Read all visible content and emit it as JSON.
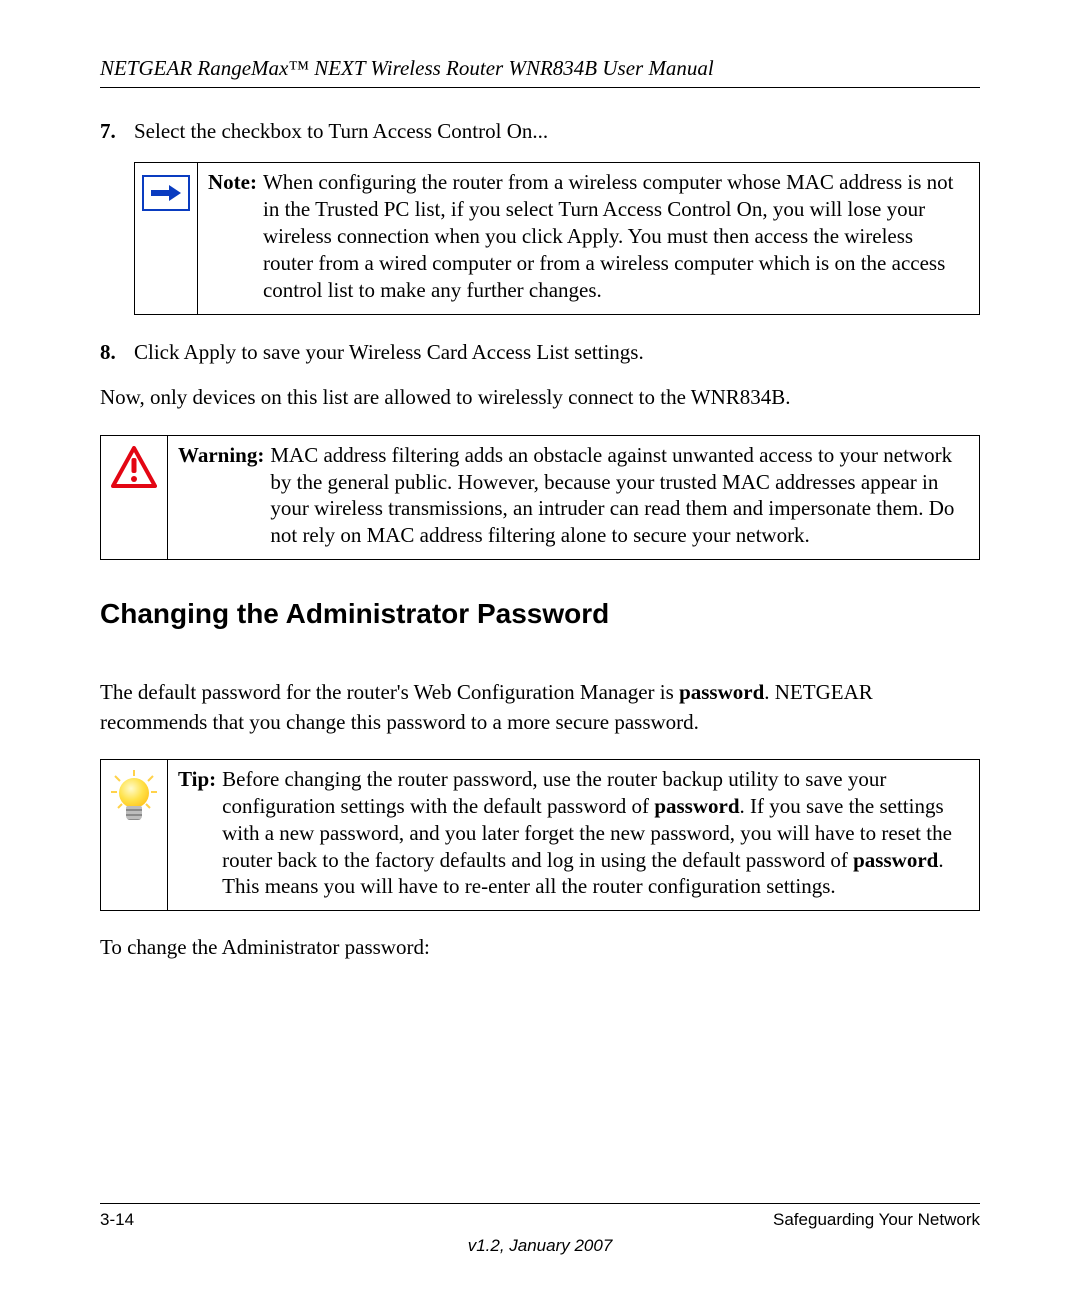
{
  "header": {
    "title": "NETGEAR RangeMax™ NEXT Wireless Router WNR834B User Manual"
  },
  "steps": {
    "s7": {
      "num": "7.",
      "text": "Select the checkbox to Turn Access Control On..."
    },
    "s8": {
      "num": "8.",
      "text": "Click Apply to save your Wireless Card Access List settings."
    }
  },
  "note": {
    "label": "Note:",
    "text": "When configuring the router from a wireless computer whose MAC address is not in the Trusted PC list, if you select Turn Access Control On, you will lose your wireless connection when you click Apply. You must then access the wireless router from a wired computer or from a wireless computer which is on the access control list to make any further changes."
  },
  "after_step8": "Now, only devices on this list are allowed to wirelessly connect to the WNR834B.",
  "warning": {
    "label": "Warning:",
    "text": "MAC address filtering adds an obstacle against unwanted access to your network by the general public. However, because your trusted MAC addresses appear in your wireless transmissions, an intruder can read them and impersonate them. Do not rely on MAC address filtering alone to secure your network."
  },
  "section_heading": "Changing the Administrator Password",
  "default_pw_para": {
    "pre": "The default password for the router's Web Configuration Manager is ",
    "bold": "password",
    "post": ". NETGEAR recommends that you change this password to a more secure password."
  },
  "tip": {
    "label": "Tip:",
    "pre": "Before changing the router password, use the router backup utility to save your configuration settings with the default password of ",
    "bold1": "password",
    "mid": ". If you save the settings with a new password, and you later forget the new password, you will have to reset the router back to the factory defaults and log in using the default password of ",
    "bold2": "password",
    "post": ". This means you will have to re-enter all the router configuration settings."
  },
  "to_change": "To change the Administrator password:",
  "footer": {
    "page": "3-14",
    "chapter": "Safeguarding Your Network",
    "version": "v1.2, January 2007"
  }
}
